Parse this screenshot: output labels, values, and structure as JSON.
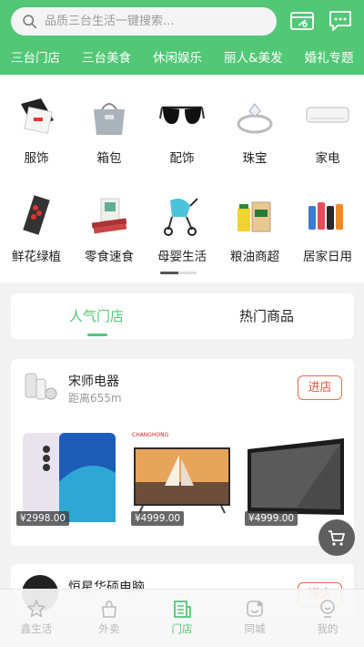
{
  "search": {
    "placeholder": "品质三台生活一键搜索..."
  },
  "header": {
    "icons": [
      "search-icon",
      "wallet-icon",
      "message-icon"
    ]
  },
  "category_tabs": [
    {
      "label": "三台门店",
      "active": true
    },
    {
      "label": "三台美食"
    },
    {
      "label": "休闲娱乐"
    },
    {
      "label": "丽人&美发"
    },
    {
      "label": "婚礼专题"
    }
  ],
  "categories": [
    {
      "label": "服饰",
      "icon": "clothing-icon"
    },
    {
      "label": "箱包",
      "icon": "bag-icon"
    },
    {
      "label": "配饰",
      "icon": "sunglasses-icon"
    },
    {
      "label": "珠宝",
      "icon": "ring-icon"
    },
    {
      "label": "家电",
      "icon": "air-conditioner-icon"
    },
    {
      "label": "鲜花绿植",
      "icon": "flower-icon"
    },
    {
      "label": "零食速食",
      "icon": "snack-icon"
    },
    {
      "label": "母婴生活",
      "icon": "stroller-icon"
    },
    {
      "label": "粮油商超",
      "icon": "grocery-icon"
    },
    {
      "label": "居家日用",
      "icon": "household-icon"
    }
  ],
  "section_tabs": [
    {
      "label": "人气门店",
      "active": true
    },
    {
      "label": "热门商品"
    }
  ],
  "stores": [
    {
      "name": "宋师电器",
      "distance": "距离655m",
      "enter_label": "进店",
      "products": [
        {
          "name": "phone",
          "price": "¥2998.00"
        },
        {
          "name": "tv-sailboat",
          "price": "¥4999.00"
        },
        {
          "name": "tv-black",
          "price": "¥4999.00"
        }
      ]
    },
    {
      "name": "恒星华硕电脑",
      "enter_label": "进店"
    }
  ],
  "bottom_nav": [
    {
      "label": "鑫生活",
      "icon": "star-home-icon"
    },
    {
      "label": "外卖",
      "icon": "takeout-icon"
    },
    {
      "label": "门店",
      "icon": "store-icon",
      "active": true
    },
    {
      "label": "同城",
      "icon": "local-icon"
    },
    {
      "label": "我的",
      "icon": "profile-icon"
    }
  ],
  "colors": {
    "accent": "#52c776",
    "enter_btn": "#e4553a"
  }
}
